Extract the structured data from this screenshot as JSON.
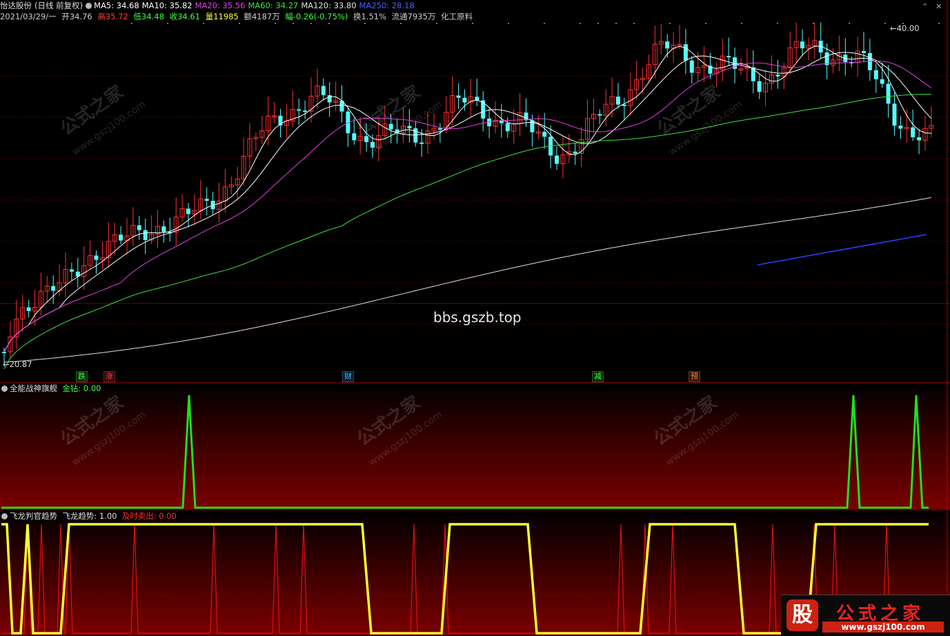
{
  "header": {
    "stock": "怡达股份",
    "mode": "(日线 前复权)",
    "ma": [
      {
        "label": "MA5: 34.68",
        "color": "#ffffff"
      },
      {
        "label": "MA10: 35.82",
        "color": "#ffffff"
      },
      {
        "label": "MA20: 35.56",
        "color": "#e040e0"
      },
      {
        "label": "MA60: 34.27",
        "color": "#40e040"
      },
      {
        "label": "MA120: 33.80",
        "color": "#e0e0e0"
      },
      {
        "label": "MA250: 28.18",
        "color": "#4060ff"
      }
    ]
  },
  "quote": {
    "date": "2021/03/29/一",
    "open": "开34.76",
    "high": "高35.72",
    "low": "低34.48",
    "close": "收34.61",
    "volume": "量11985",
    "amount": "额4187万",
    "change": "幅-0.26(-0.75%)",
    "turnover": "换1.51%",
    "float": "流通7935万",
    "industry": "化工原料"
  },
  "price_labels": {
    "high": "40.00",
    "low": "20.87"
  },
  "center_watermark": "bbs.gszb.top",
  "tags": [
    {
      "text": "跌",
      "color": "#40ff40"
    },
    {
      "text": "涨",
      "color": "#ff4040"
    },
    {
      "text": "财",
      "color": "#40c0ff"
    },
    {
      "text": "减",
      "color": "#40ff40"
    },
    {
      "text": "预",
      "color": "#ff8040"
    }
  ],
  "panel2": {
    "name": "全能战神旗舰",
    "metric": "金钻: 0.00",
    "metric_color": "#40ff40"
  },
  "panel3": {
    "name": "飞龙判官趋势",
    "metric1": "飞龙趋势: 1.00",
    "metric2": "及时卖出: 0.00",
    "metric2_color": "#ff3030"
  },
  "watermark": {
    "cn": "公式之家",
    "url": "www.gszj100.com"
  },
  "badge": {
    "icon": "股",
    "title": "公式之家",
    "url": "www.gszj100.com"
  }
}
